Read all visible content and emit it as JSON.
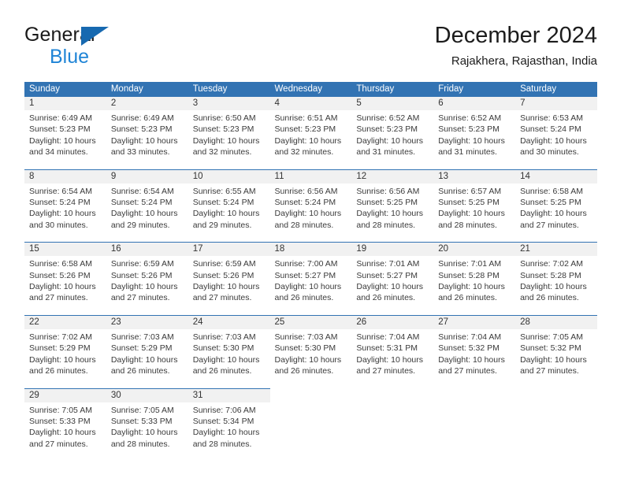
{
  "brand": {
    "name_top": "General",
    "name_bottom": "Blue",
    "triangle_color": "#1769b0",
    "blue_text_color": "#1f84d6"
  },
  "header": {
    "title": "December 2024",
    "subtitle": "Rajakhera, Rajasthan, India"
  },
  "theme": {
    "header_blue": "#3273b3",
    "daynum_gray": "#f1f1f1",
    "body_text": "#3a3a3a"
  },
  "calendar": {
    "weekday_headers": [
      "Sunday",
      "Monday",
      "Tuesday",
      "Wednesday",
      "Thursday",
      "Friday",
      "Saturday"
    ],
    "weeks": [
      {
        "days": [
          {
            "num": "1",
            "sunrise": "Sunrise: 6:49 AM",
            "sunset": "Sunset: 5:23 PM",
            "daylight_1": "Daylight: 10 hours",
            "daylight_2": "and 34 minutes."
          },
          {
            "num": "2",
            "sunrise": "Sunrise: 6:49 AM",
            "sunset": "Sunset: 5:23 PM",
            "daylight_1": "Daylight: 10 hours",
            "daylight_2": "and 33 minutes."
          },
          {
            "num": "3",
            "sunrise": "Sunrise: 6:50 AM",
            "sunset": "Sunset: 5:23 PM",
            "daylight_1": "Daylight: 10 hours",
            "daylight_2": "and 32 minutes."
          },
          {
            "num": "4",
            "sunrise": "Sunrise: 6:51 AM",
            "sunset": "Sunset: 5:23 PM",
            "daylight_1": "Daylight: 10 hours",
            "daylight_2": "and 32 minutes."
          },
          {
            "num": "5",
            "sunrise": "Sunrise: 6:52 AM",
            "sunset": "Sunset: 5:23 PM",
            "daylight_1": "Daylight: 10 hours",
            "daylight_2": "and 31 minutes."
          },
          {
            "num": "6",
            "sunrise": "Sunrise: 6:52 AM",
            "sunset": "Sunset: 5:23 PM",
            "daylight_1": "Daylight: 10 hours",
            "daylight_2": "and 31 minutes."
          },
          {
            "num": "7",
            "sunrise": "Sunrise: 6:53 AM",
            "sunset": "Sunset: 5:24 PM",
            "daylight_1": "Daylight: 10 hours",
            "daylight_2": "and 30 minutes."
          }
        ]
      },
      {
        "days": [
          {
            "num": "8",
            "sunrise": "Sunrise: 6:54 AM",
            "sunset": "Sunset: 5:24 PM",
            "daylight_1": "Daylight: 10 hours",
            "daylight_2": "and 30 minutes."
          },
          {
            "num": "9",
            "sunrise": "Sunrise: 6:54 AM",
            "sunset": "Sunset: 5:24 PM",
            "daylight_1": "Daylight: 10 hours",
            "daylight_2": "and 29 minutes."
          },
          {
            "num": "10",
            "sunrise": "Sunrise: 6:55 AM",
            "sunset": "Sunset: 5:24 PM",
            "daylight_1": "Daylight: 10 hours",
            "daylight_2": "and 29 minutes."
          },
          {
            "num": "11",
            "sunrise": "Sunrise: 6:56 AM",
            "sunset": "Sunset: 5:24 PM",
            "daylight_1": "Daylight: 10 hours",
            "daylight_2": "and 28 minutes."
          },
          {
            "num": "12",
            "sunrise": "Sunrise: 6:56 AM",
            "sunset": "Sunset: 5:25 PM",
            "daylight_1": "Daylight: 10 hours",
            "daylight_2": "and 28 minutes."
          },
          {
            "num": "13",
            "sunrise": "Sunrise: 6:57 AM",
            "sunset": "Sunset: 5:25 PM",
            "daylight_1": "Daylight: 10 hours",
            "daylight_2": "and 28 minutes."
          },
          {
            "num": "14",
            "sunrise": "Sunrise: 6:58 AM",
            "sunset": "Sunset: 5:25 PM",
            "daylight_1": "Daylight: 10 hours",
            "daylight_2": "and 27 minutes."
          }
        ]
      },
      {
        "days": [
          {
            "num": "15",
            "sunrise": "Sunrise: 6:58 AM",
            "sunset": "Sunset: 5:26 PM",
            "daylight_1": "Daylight: 10 hours",
            "daylight_2": "and 27 minutes."
          },
          {
            "num": "16",
            "sunrise": "Sunrise: 6:59 AM",
            "sunset": "Sunset: 5:26 PM",
            "daylight_1": "Daylight: 10 hours",
            "daylight_2": "and 27 minutes."
          },
          {
            "num": "17",
            "sunrise": "Sunrise: 6:59 AM",
            "sunset": "Sunset: 5:26 PM",
            "daylight_1": "Daylight: 10 hours",
            "daylight_2": "and 27 minutes."
          },
          {
            "num": "18",
            "sunrise": "Sunrise: 7:00 AM",
            "sunset": "Sunset: 5:27 PM",
            "daylight_1": "Daylight: 10 hours",
            "daylight_2": "and 26 minutes."
          },
          {
            "num": "19",
            "sunrise": "Sunrise: 7:01 AM",
            "sunset": "Sunset: 5:27 PM",
            "daylight_1": "Daylight: 10 hours",
            "daylight_2": "and 26 minutes."
          },
          {
            "num": "20",
            "sunrise": "Sunrise: 7:01 AM",
            "sunset": "Sunset: 5:28 PM",
            "daylight_1": "Daylight: 10 hours",
            "daylight_2": "and 26 minutes."
          },
          {
            "num": "21",
            "sunrise": "Sunrise: 7:02 AM",
            "sunset": "Sunset: 5:28 PM",
            "daylight_1": "Daylight: 10 hours",
            "daylight_2": "and 26 minutes."
          }
        ]
      },
      {
        "days": [
          {
            "num": "22",
            "sunrise": "Sunrise: 7:02 AM",
            "sunset": "Sunset: 5:29 PM",
            "daylight_1": "Daylight: 10 hours",
            "daylight_2": "and 26 minutes."
          },
          {
            "num": "23",
            "sunrise": "Sunrise: 7:03 AM",
            "sunset": "Sunset: 5:29 PM",
            "daylight_1": "Daylight: 10 hours",
            "daylight_2": "and 26 minutes."
          },
          {
            "num": "24",
            "sunrise": "Sunrise: 7:03 AM",
            "sunset": "Sunset: 5:30 PM",
            "daylight_1": "Daylight: 10 hours",
            "daylight_2": "and 26 minutes."
          },
          {
            "num": "25",
            "sunrise": "Sunrise: 7:03 AM",
            "sunset": "Sunset: 5:30 PM",
            "daylight_1": "Daylight: 10 hours",
            "daylight_2": "and 26 minutes."
          },
          {
            "num": "26",
            "sunrise": "Sunrise: 7:04 AM",
            "sunset": "Sunset: 5:31 PM",
            "daylight_1": "Daylight: 10 hours",
            "daylight_2": "and 27 minutes."
          },
          {
            "num": "27",
            "sunrise": "Sunrise: 7:04 AM",
            "sunset": "Sunset: 5:32 PM",
            "daylight_1": "Daylight: 10 hours",
            "daylight_2": "and 27 minutes."
          },
          {
            "num": "28",
            "sunrise": "Sunrise: 7:05 AM",
            "sunset": "Sunset: 5:32 PM",
            "daylight_1": "Daylight: 10 hours",
            "daylight_2": "and 27 minutes."
          }
        ]
      },
      {
        "days": [
          {
            "num": "29",
            "sunrise": "Sunrise: 7:05 AM",
            "sunset": "Sunset: 5:33 PM",
            "daylight_1": "Daylight: 10 hours",
            "daylight_2": "and 27 minutes."
          },
          {
            "num": "30",
            "sunrise": "Sunrise: 7:05 AM",
            "sunset": "Sunset: 5:33 PM",
            "daylight_1": "Daylight: 10 hours",
            "daylight_2": "and 28 minutes."
          },
          {
            "num": "31",
            "sunrise": "Sunrise: 7:06 AM",
            "sunset": "Sunset: 5:34 PM",
            "daylight_1": "Daylight: 10 hours",
            "daylight_2": "and 28 minutes."
          },
          {
            "num": "",
            "sunrise": "",
            "sunset": "",
            "daylight_1": "",
            "daylight_2": ""
          },
          {
            "num": "",
            "sunrise": "",
            "sunset": "",
            "daylight_1": "",
            "daylight_2": ""
          },
          {
            "num": "",
            "sunrise": "",
            "sunset": "",
            "daylight_1": "",
            "daylight_2": ""
          },
          {
            "num": "",
            "sunrise": "",
            "sunset": "",
            "daylight_1": "",
            "daylight_2": ""
          }
        ]
      }
    ]
  }
}
